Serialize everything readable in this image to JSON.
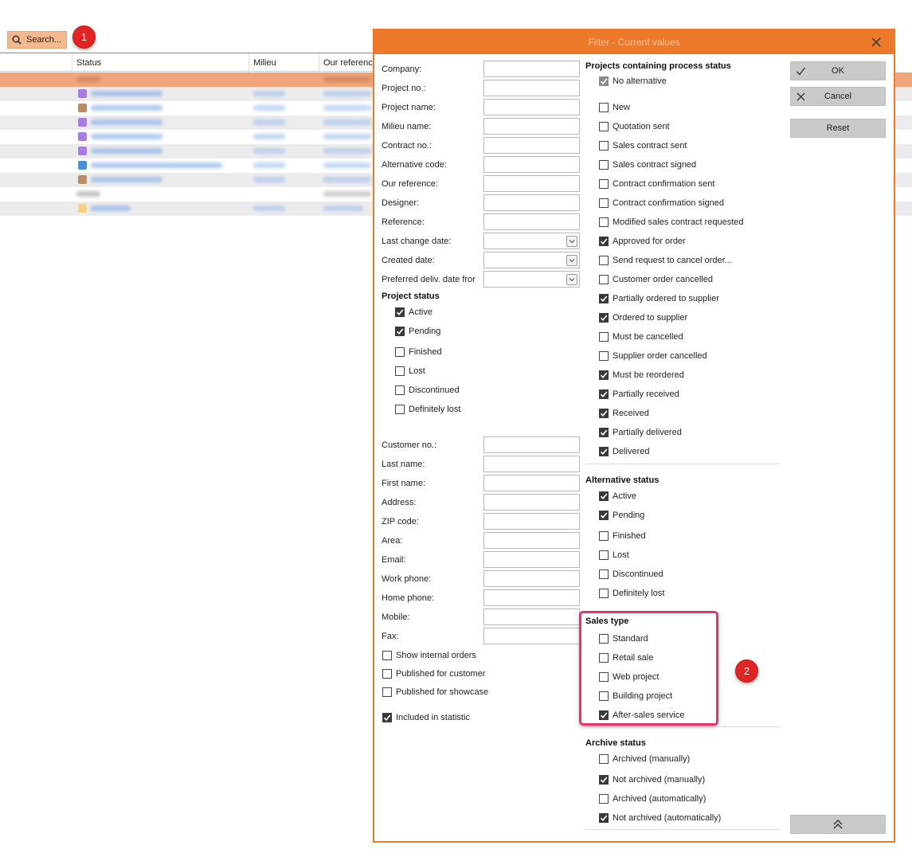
{
  "background": {
    "search_label": "Search...",
    "columns": [
      "Status",
      "Milieu",
      "Our referenc"
    ],
    "badge1": "1"
  },
  "dialog": {
    "title": "Filter - Current values",
    "fields": [
      {
        "label": "Company:",
        "value": ""
      },
      {
        "label": "Project no.:",
        "value": ""
      },
      {
        "label": "Project name:",
        "value": ""
      },
      {
        "label": "Milieu name:",
        "value": ""
      },
      {
        "label": "Contract no.:",
        "value": ""
      },
      {
        "label": "Alternative code:",
        "value": ""
      },
      {
        "label": "Our reference:",
        "value": ""
      },
      {
        "label": "Designer:",
        "value": ""
      },
      {
        "label": "Reference:",
        "value": ""
      },
      {
        "label": "Last change date:",
        "value": ""
      },
      {
        "label": "Created date:",
        "value": ""
      },
      {
        "label": "Preferred deliv. date fror",
        "value": ""
      }
    ],
    "project_status": {
      "title": "Project status",
      "items": [
        {
          "label": "Active",
          "checked": true
        },
        {
          "label": "Pending",
          "checked": true
        },
        {
          "label": "Finished",
          "checked": false
        },
        {
          "label": "Lost",
          "checked": false
        },
        {
          "label": "Discontinued",
          "checked": false
        },
        {
          "label": "Definitely lost",
          "checked": false
        }
      ]
    },
    "customer_fields": [
      {
        "label": "Customer no.:",
        "value": ""
      },
      {
        "label": "Last name:",
        "value": ""
      },
      {
        "label": "First name:",
        "value": ""
      },
      {
        "label": "Address:",
        "value": ""
      },
      {
        "label": "ZIP code:",
        "value": ""
      },
      {
        "label": "Area:",
        "value": ""
      },
      {
        "label": "Email:",
        "value": ""
      },
      {
        "label": "Work phone:",
        "value": ""
      },
      {
        "label": "Home phone:",
        "value": ""
      },
      {
        "label": "Mobile:",
        "value": ""
      },
      {
        "label": "Fax:",
        "value": ""
      }
    ],
    "left_checks": [
      {
        "label": "Show internal orders",
        "checked": false
      },
      {
        "label": "Published for customer",
        "checked": false
      },
      {
        "label": "Published for showcase",
        "checked": false
      },
      {
        "label": "Included in statistic",
        "checked": true
      }
    ],
    "process_status": {
      "title": "Projects containing process status",
      "items": [
        {
          "label": "No alternative",
          "checked": true
        },
        {
          "label": "New",
          "checked": false
        },
        {
          "label": "Quotation sent",
          "checked": false
        },
        {
          "label": "Sales contract sent",
          "checked": false
        },
        {
          "label": "Sales contract signed",
          "checked": false
        },
        {
          "label": "Contract confirmation sent",
          "checked": false
        },
        {
          "label": "Contract confirmation signed",
          "checked": false
        },
        {
          "label": "Modified sales contract requested",
          "checked": false
        },
        {
          "label": "Approved for order",
          "checked": true
        },
        {
          "label": "Send request to cancel order...",
          "checked": false
        },
        {
          "label": "Customer order cancelled",
          "checked": false
        },
        {
          "label": "Partially ordered to supplier",
          "checked": true
        },
        {
          "label": "Ordered to supplier",
          "checked": true
        },
        {
          "label": "Must be cancelled",
          "checked": false
        },
        {
          "label": "Supplier order cancelled",
          "checked": false
        },
        {
          "label": "Must be reordered",
          "checked": true
        },
        {
          "label": "Partially received",
          "checked": true
        },
        {
          "label": "Received",
          "checked": true
        },
        {
          "label": "Partially delivered",
          "checked": true
        },
        {
          "label": "Delivered",
          "checked": true
        }
      ]
    },
    "alternative_status": {
      "title": "Alternative status",
      "items": [
        {
          "label": "Active",
          "checked": true
        },
        {
          "label": "Pending",
          "checked": true
        },
        {
          "label": "Finished",
          "checked": false
        },
        {
          "label": "Lost",
          "checked": false
        },
        {
          "label": "Discontinued",
          "checked": false
        },
        {
          "label": "Definitely lost",
          "checked": false
        }
      ]
    },
    "sales_type": {
      "title": "Sales type",
      "items": [
        {
          "label": "Standard",
          "checked": false
        },
        {
          "label": "Retail sale",
          "checked": false
        },
        {
          "label": "Web project",
          "checked": false
        },
        {
          "label": "Building project",
          "checked": false
        },
        {
          "label": "After-sales service",
          "checked": true
        }
      ]
    },
    "archive_status": {
      "title": "Archive status",
      "items": [
        {
          "label": "Archived (manually)",
          "checked": false
        },
        {
          "label": "Not archived (manually)",
          "checked": true
        },
        {
          "label": "Archived (automatically)",
          "checked": false
        },
        {
          "label": "Not archived (automatically)",
          "checked": true
        }
      ]
    },
    "buttons": {
      "ok": "OK",
      "cancel": "Cancel",
      "reset": "Reset"
    },
    "badge2": "2"
  },
  "colors": {
    "accent": "#ec7a2a",
    "highlight": "#e8326a",
    "badge": "#e02424"
  }
}
